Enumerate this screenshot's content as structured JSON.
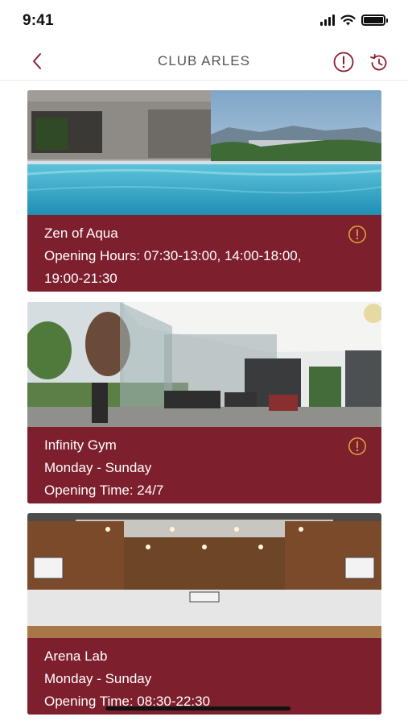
{
  "status_bar": {
    "time": "9:41"
  },
  "nav": {
    "title": "CLUB ARLES",
    "back_icon": "chevron-left-icon",
    "alert_icon": "alert-circle-icon",
    "history_icon": "history-icon"
  },
  "colors": {
    "brand": "#7e1f2d",
    "accent_gold": "#d9a23a",
    "icon_red": "#8a1e2e"
  },
  "facilities": [
    {
      "name": "Zen of Aqua",
      "line2": "Opening Hours: 07:30-13:00, 14:00-18:00,",
      "line3": "19:00-21:30",
      "image": "outdoor-pool-photo",
      "has_info_icon": true
    },
    {
      "name": "Infinity Gym",
      "line2": "Monday - Sunday",
      "line3": "Opening Time: 24/7",
      "image": "gym-photo",
      "has_info_icon": true
    },
    {
      "name": "Arena Lab",
      "line2": "Monday - Sunday",
      "line3": "Opening Time: 08:30-22:30",
      "image": "basketball-court-photo",
      "has_info_icon": false
    }
  ]
}
